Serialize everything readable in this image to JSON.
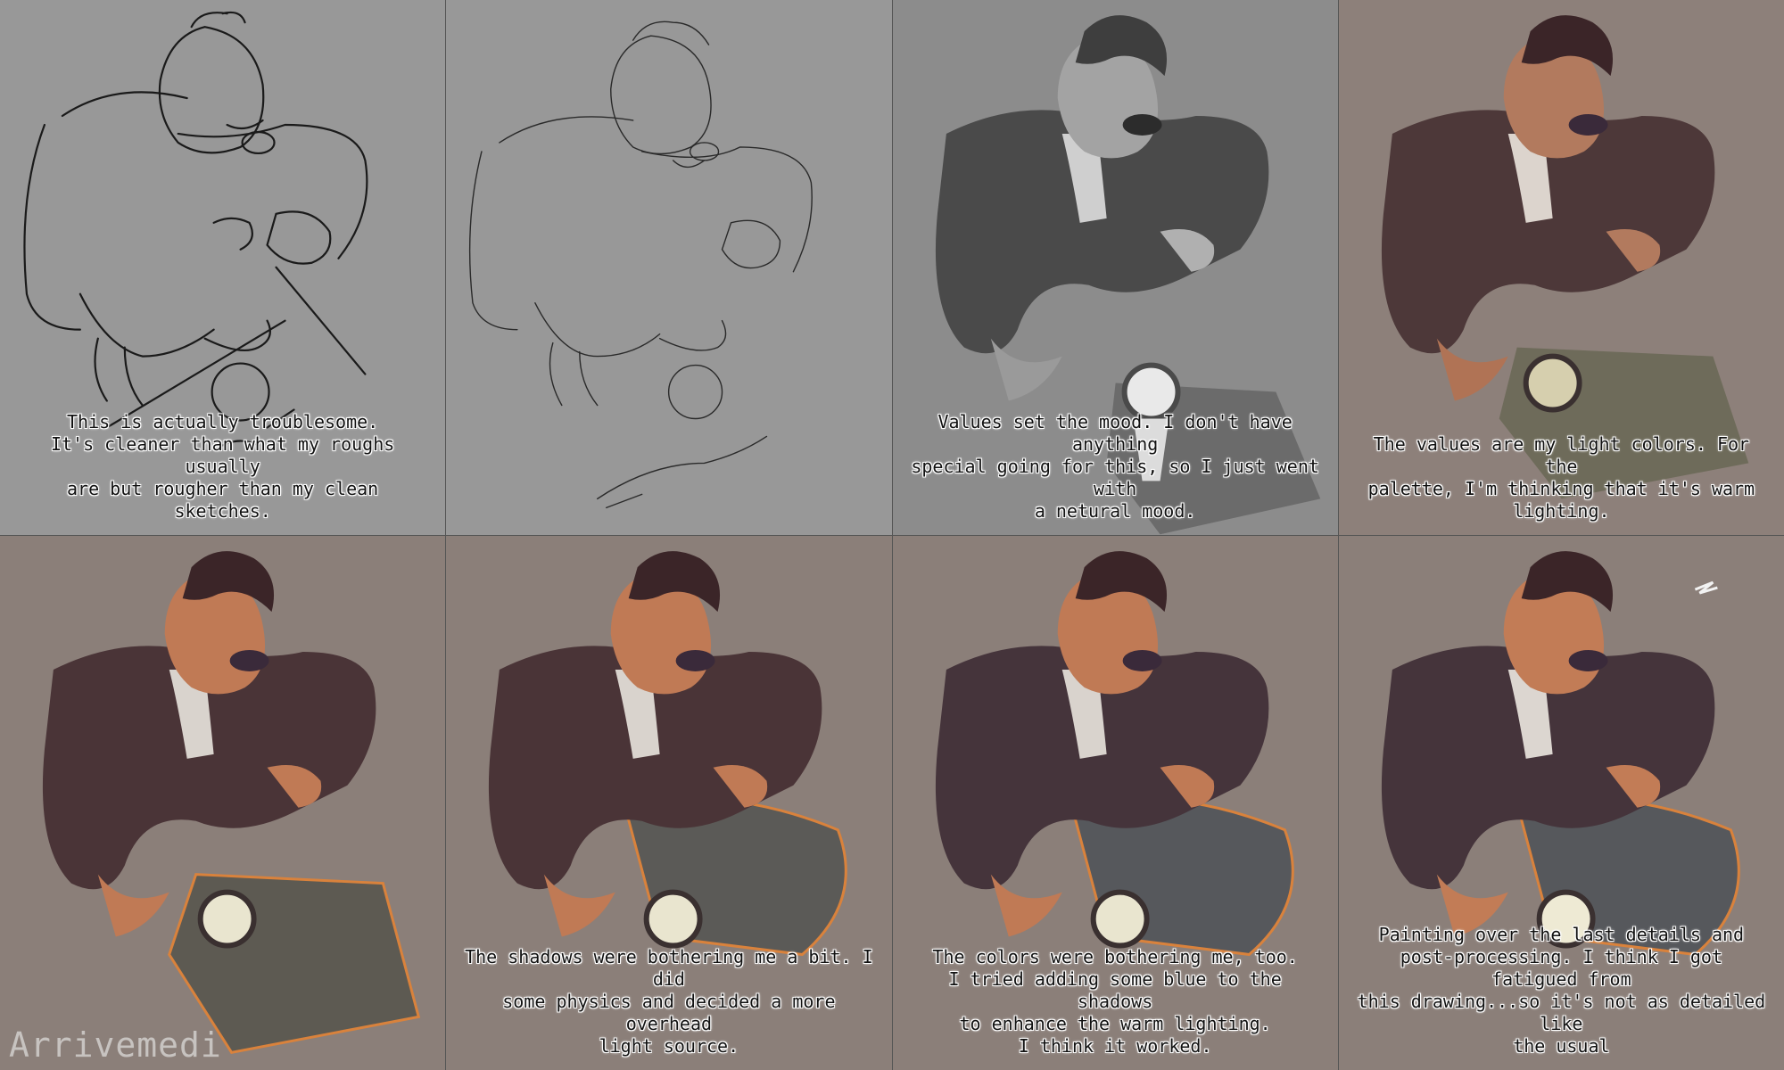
{
  "colors": {
    "background_sketch": "#989898",
    "background_gray": "#8c8c8c",
    "background_warm": "#8b7f79",
    "jacket": "#4a3437",
    "skin": "#c07a55",
    "hair": "#3b2528",
    "shirt": "#d9d3cd",
    "magnifier_glow": "#e9e5cf",
    "shadow": "#5b5a57",
    "rim_orange": "#d9823c"
  },
  "panels": [
    {
      "name": "rough-sketch",
      "caption": "This is actually troublesome.\nIt's cleaner than what my roughs usually\nare but rougher than my clean sketches."
    },
    {
      "name": "clean-lineart",
      "caption": ""
    },
    {
      "name": "values",
      "caption": "Values set the mood. I don't have anything\nspecial going for this, so I just went with\na netural mood."
    },
    {
      "name": "light-colors",
      "caption": "The values are my light colors. For the\npalette, I'm thinking that it's warm lighting."
    },
    {
      "name": "base-render",
      "caption": ""
    },
    {
      "name": "shadow-physics",
      "caption": "The shadows were bothering me a bit. I did\nsome physics and decided a more overhead\nlight source."
    },
    {
      "name": "blue-shadows",
      "caption": "The colors were bothering me, too.\nI tried adding some blue to the shadows\nto enhance the warm lighting.\nI think it worked."
    },
    {
      "name": "final-details",
      "caption": "Painting over the last details and\npost-processing. I think I got fatigued from\nthis drawing...so it's not as detailed like\nthe usual"
    }
  ],
  "watermark": "Arrivemedi"
}
